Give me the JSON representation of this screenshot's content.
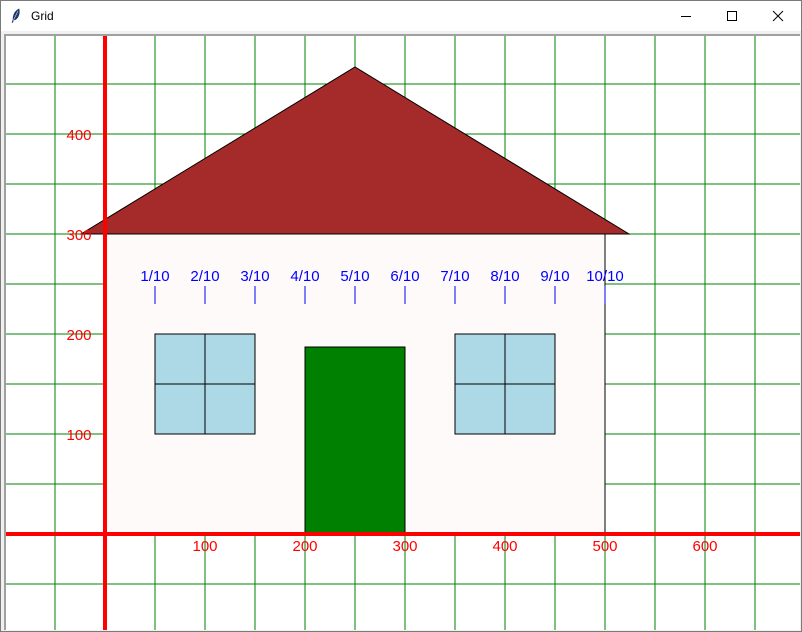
{
  "window": {
    "title": "Grid",
    "icon": "feather-icon",
    "controls": [
      "minimize-icon",
      "maximize-icon",
      "close-icon"
    ]
  },
  "canvas": {
    "grid_color": "#008000",
    "axis_color": "#ff0000",
    "x_tick_labels": [
      "100",
      "200",
      "300",
      "400",
      "500",
      "600"
    ],
    "y_tick_labels": [
      "100",
      "200",
      "300",
      "400"
    ],
    "fraction_labels": [
      "1/10",
      "2/10",
      "3/10",
      "4/10",
      "5/10",
      "6/10",
      "7/10",
      "8/10",
      "9/10",
      "10/10"
    ],
    "fraction_color": "#0000ff",
    "house": {
      "roof_color": "#a52a2a",
      "wall_color": "#fffafa",
      "window_color": "#add8e6",
      "door_color": "#008000"
    }
  }
}
